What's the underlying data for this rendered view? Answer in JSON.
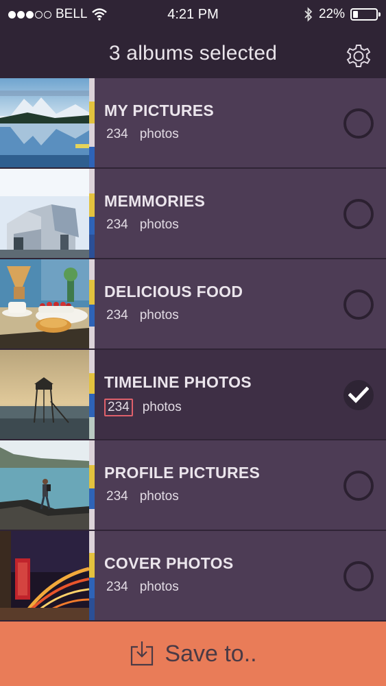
{
  "status_bar": {
    "carrier": "BELL",
    "time": "4:21 PM",
    "battery": "22%",
    "battery_level": 0.22,
    "signal_strength": 3
  },
  "header": {
    "title": "3 albums selected",
    "settings_icon": "gear-icon"
  },
  "albums": [
    {
      "title": "MY PICTURES",
      "count": "234",
      "unit": "photos",
      "selected": false
    },
    {
      "title": "MEMMORIES",
      "count": "234",
      "unit": "photos",
      "selected": false
    },
    {
      "title": "DELICIOUS FOOD",
      "count": "234",
      "unit": "photos",
      "selected": false
    },
    {
      "title": "TIMELINE PHOTOS",
      "count": "234",
      "unit": "photos",
      "selected": true
    },
    {
      "title": "PROFILE PICTURES",
      "count": "234",
      "unit": "photos",
      "selected": false
    },
    {
      "title": "COVER PHOTOS",
      "count": "234",
      "unit": "photos",
      "selected": false
    }
  ],
  "footer": {
    "save_label": "Save to..",
    "save_icon": "download-tray-icon"
  },
  "colors": {
    "background": "#2f2435",
    "row": "#4d3c55",
    "row_selected": "#3e2f45",
    "accent": "#e97c58",
    "count_highlight": "#e0616b"
  }
}
